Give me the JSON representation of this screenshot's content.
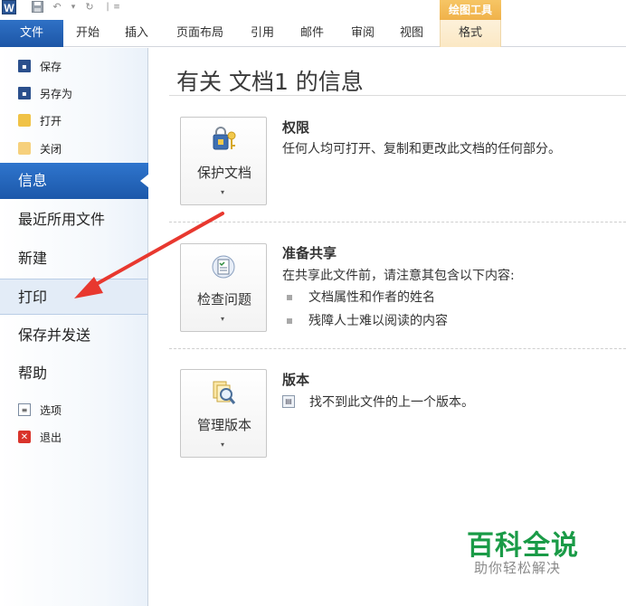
{
  "quick_access": {
    "app_icon": "W"
  },
  "contextual_tab_group": "绘图工具",
  "ribbon_tabs": [
    {
      "label": "文件"
    },
    {
      "label": "开始"
    },
    {
      "label": "插入"
    },
    {
      "label": "页面布局"
    },
    {
      "label": "引用"
    },
    {
      "label": "邮件"
    },
    {
      "label": "审阅"
    },
    {
      "label": "视图"
    },
    {
      "label": "格式"
    }
  ],
  "nav": {
    "top_items": [
      {
        "label": "保存",
        "icon": "save-icon"
      },
      {
        "label": "另存为",
        "icon": "save-as-icon"
      },
      {
        "label": "打开",
        "icon": "open-folder-icon"
      },
      {
        "label": "关闭",
        "icon": "close-folder-icon"
      }
    ],
    "main_items": [
      {
        "label": "信息",
        "active": true
      },
      {
        "label": "最近所用文件"
      },
      {
        "label": "新建"
      },
      {
        "label": "打印",
        "hover": true
      },
      {
        "label": "保存并发送"
      },
      {
        "label": "帮助"
      }
    ],
    "bottom_items": [
      {
        "label": "选项",
        "icon": "options-icon"
      },
      {
        "label": "退出",
        "icon": "exit-icon"
      }
    ]
  },
  "main": {
    "title": "有关 文档1 的信息",
    "sections": [
      {
        "button_label": "保护文档",
        "button_icon": "lock-keys-icon",
        "heading": "权限",
        "text": "任何人均可打开、复制和更改此文档的任何部分。"
      },
      {
        "button_label": "检查问题",
        "button_icon": "checklist-icon",
        "heading": "准备共享",
        "text": "在共享此文件前，请注意其包含以下内容:",
        "bullets": [
          "文档属性和作者的姓名",
          "残障人士难以阅读的内容"
        ]
      },
      {
        "button_label": "管理版本",
        "button_icon": "version-magnifier-icon",
        "heading": "版本",
        "text": "找不到此文件的上一个版本。"
      }
    ]
  },
  "watermark": {
    "title": "百科全说",
    "subtitle": "助你轻松解决"
  },
  "colors": {
    "file_tab": "#1d56a6",
    "active_nav": "#2f75cd",
    "context_tab": "#f0b24a",
    "arrow": "#e8382f",
    "watermark": "#1a9b47"
  }
}
